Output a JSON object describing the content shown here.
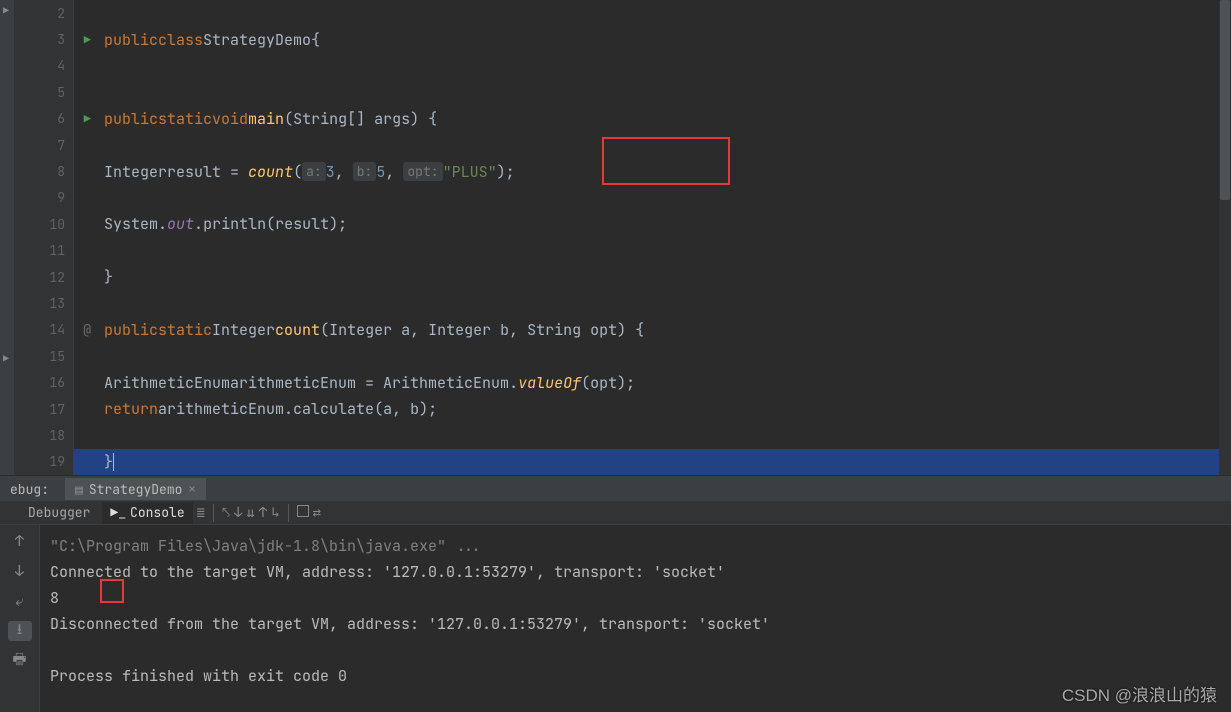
{
  "editor": {
    "lines": [
      {
        "n": "2"
      },
      {
        "n": "3",
        "run": true,
        "fold": "open"
      },
      {
        "n": "4"
      },
      {
        "n": "5"
      },
      {
        "n": "6",
        "run": true,
        "fold": "open"
      },
      {
        "n": "7"
      },
      {
        "n": "8"
      },
      {
        "n": "9"
      },
      {
        "n": "10"
      },
      {
        "n": "11"
      },
      {
        "n": "12",
        "fold": "close"
      },
      {
        "n": "13"
      },
      {
        "n": "14",
        "at": true,
        "fold": "open"
      },
      {
        "n": "15"
      },
      {
        "n": "16"
      },
      {
        "n": "17"
      },
      {
        "n": "18"
      },
      {
        "n": "19"
      }
    ],
    "tokens": {
      "public": "public",
      "class": "class",
      "StrategyDemo": "StrategyDemo",
      "lbrace": "{",
      "rbrace": "}",
      "static": "static",
      "void": "void",
      "main": "main",
      "main_params": "(String[] args) {",
      "Integer": "Integer",
      "result": "result",
      "eq": " = ",
      "count": "count",
      "lp": "(",
      "hint_a": "a:",
      "val_a": "3",
      "comma": ", ",
      "hint_b": "b:",
      "val_b": "5",
      "hint_opt": "opt:",
      "val_opt": "\"PLUS\"",
      "rp_semi": ");",
      "System": "System",
      "dot": ".",
      "out": "out",
      "println": "println",
      "println_arg": "(result);",
      "count_sig": "(Integer a, Integer b, String opt) {",
      "ArithmeticEnum": "ArithmeticEnum",
      "arithmeticEnum": "arithmeticEnum",
      "valueOf": "valueOf",
      "valueOf_arg": "(opt);",
      "return": "return",
      "calculate": "calculate",
      "calc_arg": "(a, b);"
    }
  },
  "panel": {
    "title": "ebug:",
    "tab": "StrategyDemo",
    "sub": {
      "debugger": "Debugger",
      "console": "Console"
    }
  },
  "console": {
    "l1": "\"C:\\Program Files\\Java\\jdk-1.8\\bin\\java.exe\" ...",
    "l2": "Connected to the target VM, address: '127.0.0.1:53279', transport: 'socket'",
    "l3": "8",
    "l4": "Disconnected from the target VM, address: '127.0.0.1:53279', transport: 'socket'",
    "l5": "Process finished with exit code 0"
  },
  "watermark": "CSDN @浪浪山的猿"
}
